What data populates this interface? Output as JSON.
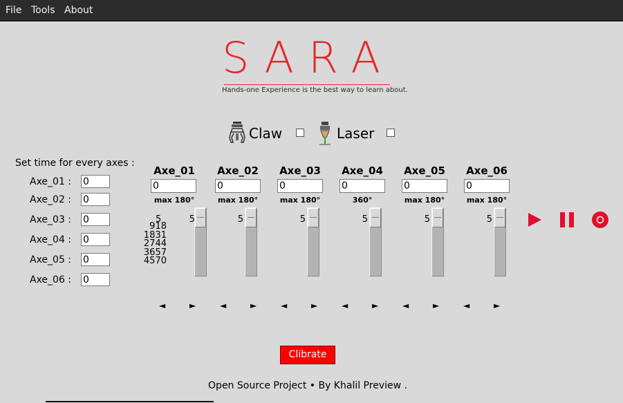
{
  "menu": [
    "File",
    "Tools",
    "About"
  ],
  "logo": {
    "title": "SARA",
    "subtitle": "Hands-one Experience is the best way to learn about."
  },
  "tools": {
    "claw_label": "Claw",
    "laser_label": "Laser"
  },
  "time_panel": {
    "title": "Set time for every axes :",
    "rows": [
      {
        "label": "Axe_01 :",
        "value": "0"
      },
      {
        "label": "Axe_02 :",
        "value": "0"
      },
      {
        "label": "Axe_03 :",
        "value": "0"
      },
      {
        "label": "Axe_04 :",
        "value": "0"
      },
      {
        "label": "Axe_05 :",
        "value": "0"
      },
      {
        "label": "Axe_06 :",
        "value": "0"
      }
    ]
  },
  "axes": [
    {
      "name": "Axe_01",
      "input": "0",
      "max": "max 180°",
      "value": "5"
    },
    {
      "name": "Axe_02",
      "input": "0",
      "max": "max 180°",
      "value": "5"
    },
    {
      "name": "Axe_03",
      "input": "0",
      "max": "max 180°",
      "value": "5"
    },
    {
      "name": "Axe_04",
      "input": "0",
      "max": "360°",
      "value": "5"
    },
    {
      "name": "Axe_05",
      "input": "0",
      "max": "max 180°",
      "value": "5"
    },
    {
      "name": "Axe_06",
      "input": "0",
      "max": "max 180°",
      "value": "5"
    }
  ],
  "scale_ticks": [
    "5",
    "918",
    "1831",
    "2744",
    "3657",
    "4570"
  ],
  "arrows": {
    "left": "◄",
    "right": "►"
  },
  "calibrate_label": "Clibrate",
  "footer": "Open Source Project • By Khalil Preview .",
  "colors": {
    "accent": "#e8262b",
    "control": "#e0102e",
    "calibrate": "#ff0000"
  }
}
